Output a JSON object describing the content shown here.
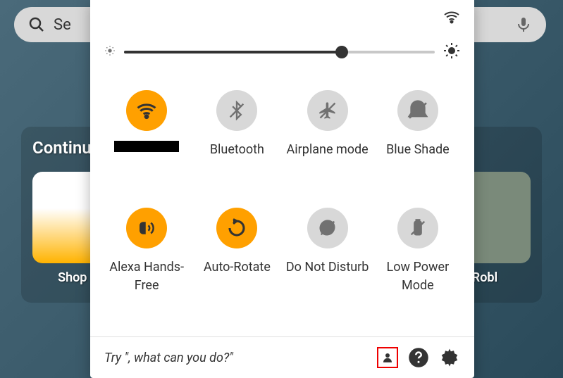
{
  "search": {
    "placeholder": "Se"
  },
  "continue": {
    "label": "Continu",
    "apps": [
      {
        "label": "Shop A"
      },
      {
        "label": "Robl"
      }
    ]
  },
  "brightness": {
    "value": 70
  },
  "toggles": {
    "wifi": {
      "label": "",
      "on": true,
      "redacted": true
    },
    "bluetooth": {
      "label": "Bluetooth",
      "on": false
    },
    "airplane": {
      "label": "Airplane mode",
      "on": false
    },
    "blueshade": {
      "label": "Blue Shade",
      "on": false
    },
    "alexa": {
      "label": "Alexa Hands-Free",
      "on": true
    },
    "autorotate": {
      "label": "Auto-Rotate",
      "on": true
    },
    "dnd": {
      "label": "Do Not Disturb",
      "on": false
    },
    "lowpower": {
      "label": "Low Power Mode",
      "on": false
    }
  },
  "footer": {
    "hint": "Try \", what can you do?\""
  },
  "colors": {
    "accent": "#ffa000",
    "highlight": "#e00000"
  }
}
